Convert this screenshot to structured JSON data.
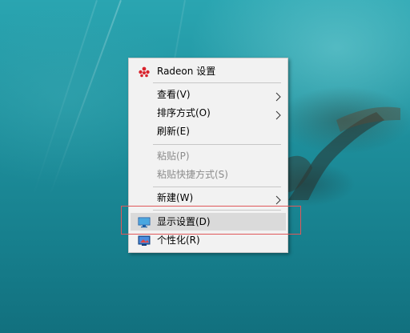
{
  "context_menu": {
    "radeon_label": "Radeon 设置",
    "view_label": "查看(V)",
    "sort_label": "排序方式(O)",
    "refresh_label": "刷新(E)",
    "paste_label": "粘贴(P)",
    "paste_shortcut_label": "粘贴快捷方式(S)",
    "new_label": "新建(W)",
    "display_settings_label": "显示设置(D)",
    "personalize_label": "个性化(R)"
  },
  "colors": {
    "highlight_border": "#e0585a",
    "hover_background": "#dadada",
    "radeon_red": "#d9232d"
  }
}
